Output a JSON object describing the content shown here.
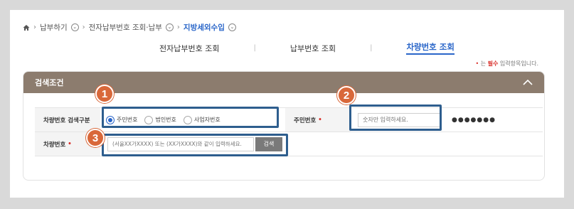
{
  "breadcrumb": {
    "items": [
      "납부하기",
      "전자납부번호 조회·납부",
      "지방세외수입"
    ],
    "circle_glyph": "⌄"
  },
  "tabs": [
    {
      "label": "전자납부번호 조회",
      "active": false
    },
    {
      "label": "납부번호 조회",
      "active": false
    },
    {
      "label": "차량번호 조회",
      "active": true
    }
  ],
  "tab_divider": "|",
  "required_note": {
    "star": "•",
    "prefix": "는 ",
    "required": "필수",
    "suffix": " 입력항목입니다."
  },
  "panel": {
    "title": "검색조건",
    "row1": {
      "label": "차량번호 검색구분",
      "radios": [
        {
          "label": "주민번호",
          "selected": true
        },
        {
          "label": "법인번호",
          "selected": false
        },
        {
          "label": "사업자번호",
          "selected": false
        }
      ],
      "label2": "주민번호",
      "id_placeholder": "숫자만 입력하세요.",
      "masked_value": "●●●●●●●"
    },
    "row2": {
      "label": "차량번호",
      "car_placeholder": "(서울XX가XXXX) 또는 (XX가XXXX)와 같이 입력하세요.",
      "search_button": "검색"
    }
  },
  "required_star": "•",
  "callouts": [
    "1",
    "2",
    "3"
  ],
  "colors": {
    "accent": "#2a66c9",
    "header": "#8c7c6e",
    "badge": "#d9683a",
    "highlight": "#2e5e8e",
    "required": "#d9302b"
  }
}
